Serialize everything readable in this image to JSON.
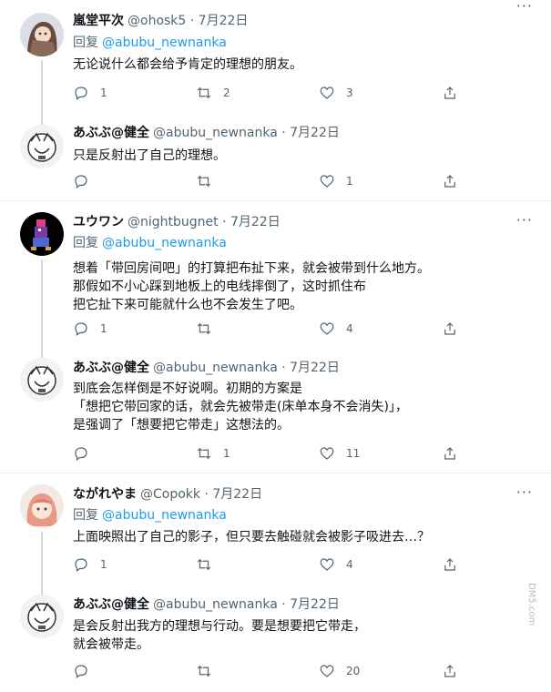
{
  "tweets": [
    {
      "name": "嵐堂平次",
      "handle": "@ohosk5 · 7月22日",
      "replying_label": "回复",
      "replying_to": "@abubu_newnanka",
      "body": [
        "无论说什么都会给予肯定的理想的朋友。"
      ],
      "reply_count": "1",
      "retweet_count": "2",
      "like_count": "3"
    },
    {
      "name": "あぶぶ@健全",
      "handle": "@abubu_newnanka · 7月22日",
      "body": [
        "只是反射出了自己的理想。"
      ],
      "reply_count": "",
      "retweet_count": "",
      "like_count": "1"
    },
    {
      "name": "ユウワン",
      "handle": "@nightbugnet · 7月22日",
      "replying_label": "回复",
      "replying_to": "@abubu_newnanka",
      "body": [
        "想着「带回房间吧」的打算把布扯下来，就会被带到什么地方。",
        "那假如不小心踩到地板上的电线摔倒了，这时抓住布",
        "把它扯下来可能就什么也不会发生了吧。"
      ],
      "reply_count": "1",
      "retweet_count": "",
      "like_count": "4"
    },
    {
      "name": "あぶぶ@健全",
      "handle": "@abubu_newnanka · 7月22日",
      "body": [
        "到底会怎样倒是不好说啊。初期的方案是",
        "「想把它带回家的话，就会先被带走(床单本身不会消失)」，",
        "是强调了「想要把它带走」这想法的。"
      ],
      "reply_count": "",
      "retweet_count": "1",
      "like_count": "11"
    },
    {
      "name": "ながれやま",
      "handle": "@Copokk · 7月22日",
      "replying_label": "回复",
      "replying_to": "@abubu_newnanka",
      "body": [
        "上面映照出了自己的影子，但只要去触碰就会被影子吸进去…？"
      ],
      "reply_count": "1",
      "retweet_count": "",
      "like_count": "4"
    },
    {
      "name": "あぶぶ@健全",
      "handle": "@abubu_newnanka · 7月22日",
      "body": [
        "是会反射出我方的理想与行动。要是想要把它带走，",
        "就会被带走。"
      ],
      "reply_count": "",
      "retweet_count": "",
      "like_count": "20"
    }
  ],
  "more_glyph": "···",
  "watermark": "DM5.com",
  "colors": {
    "text": "#0f1419",
    "secondary": "#536471",
    "link": "#1d9bf0",
    "separator": "#e6ecf0"
  }
}
